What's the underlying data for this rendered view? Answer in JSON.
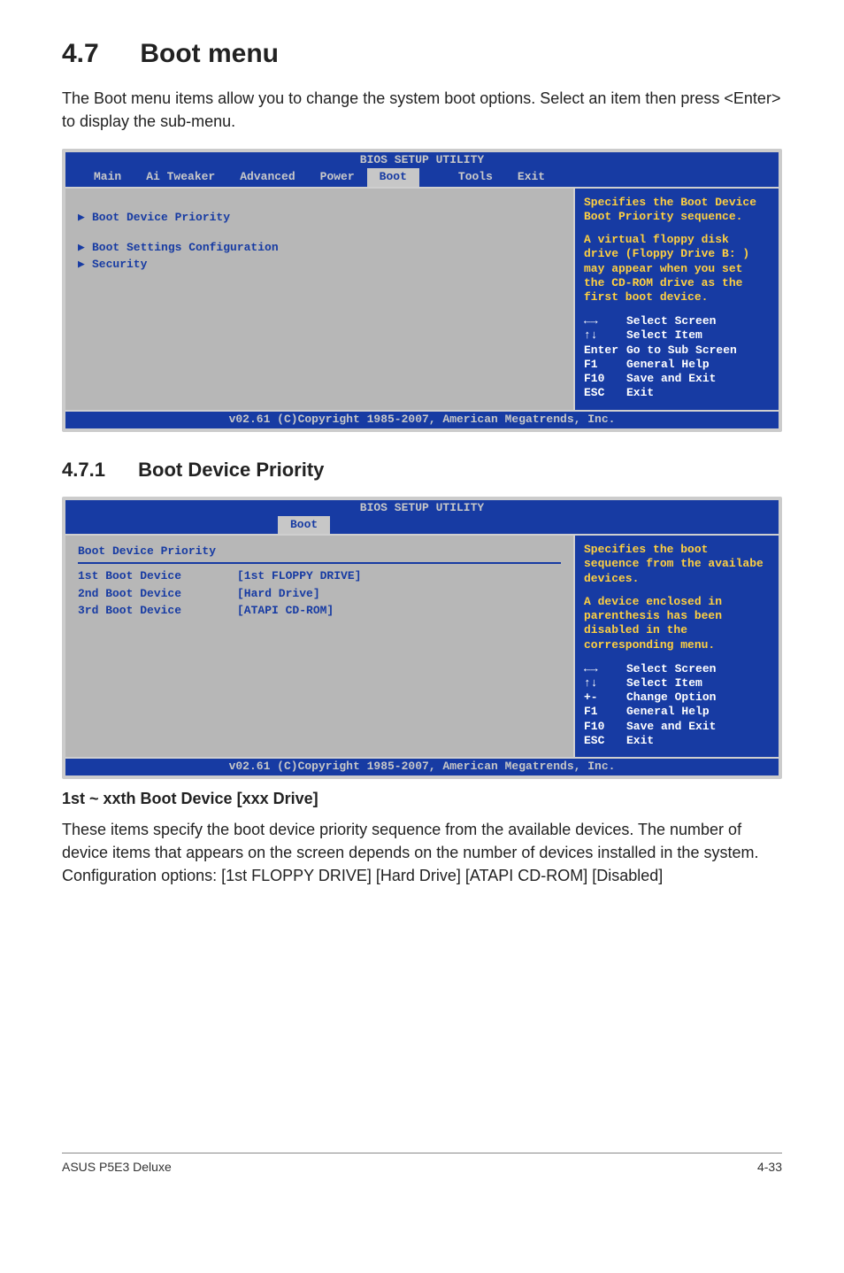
{
  "heading": {
    "num": "4.7",
    "title": "Boot menu"
  },
  "intro": "The Boot menu items allow you to change the system boot options. Select an item then press <Enter> to display the sub-menu.",
  "bios1": {
    "header": "BIOS SETUP UTILITY",
    "tabs": [
      "Main",
      "Ai Tweaker",
      "Advanced",
      "Power",
      "Boot",
      "Tools",
      "Exit"
    ],
    "selectedTab": "Boot",
    "left_items": [
      {
        "arrow": true,
        "label": "Boot Device Priority"
      },
      {
        "arrow": true,
        "label": "Boot Settings Configuration"
      },
      {
        "arrow": true,
        "label": "Security"
      }
    ],
    "right_desc1": "Specifies the Boot Device Boot Priority sequence.",
    "right_desc2": "A virtual floppy disk drive (Floppy Drive B: ) may appear when you set the CD-ROM drive as the first boot device.",
    "nav": [
      {
        "key": "←→",
        "label": "Select Screen"
      },
      {
        "key": "↑↓",
        "label": "Select Item"
      },
      {
        "key": "Enter",
        "label": "Go to Sub Screen"
      },
      {
        "key": "F1",
        "label": "General Help"
      },
      {
        "key": "F10",
        "label": "Save and Exit"
      },
      {
        "key": "ESC",
        "label": "Exit"
      }
    ],
    "footer": "v02.61 (C)Copyright 1985-2007, American Megatrends, Inc."
  },
  "subheading": {
    "num": "4.7.1",
    "title": "Boot Device Priority"
  },
  "bios2": {
    "header": "BIOS SETUP UTILITY",
    "single_tab": "Boot",
    "section_head": "Boot Device Priority",
    "rows": [
      {
        "label": "1st Boot Device",
        "value": "[1st FLOPPY DRIVE]"
      },
      {
        "label": "2nd Boot Device",
        "value": "[Hard Drive]"
      },
      {
        "label": "3rd Boot Device",
        "value": "[ATAPI CD-ROM]"
      }
    ],
    "right_desc1": "Specifies the boot sequence from the availabe devices.",
    "right_desc2": "A device enclosed in parenthesis has been disabled in the corresponding menu.",
    "nav": [
      {
        "key": "←→",
        "label": "Select Screen"
      },
      {
        "key": "↑↓",
        "label": "Select Item"
      },
      {
        "key": "+-",
        "label": "Change Option"
      },
      {
        "key": "F1",
        "label": "General Help"
      },
      {
        "key": "F10",
        "label": "Save and Exit"
      },
      {
        "key": "ESC",
        "label": "Exit"
      }
    ],
    "footer": "v02.61 (C)Copyright 1985-2007, American Megatrends, Inc."
  },
  "para_title": "1st ~ xxth Boot Device [xxx Drive]",
  "para_body": "These items specify the boot device priority sequence from the available devices. The number of device items that appears on the screen depends on the number of devices installed in the system. Configuration options: [1st FLOPPY DRIVE] [Hard Drive] [ATAPI CD-ROM] [Disabled]",
  "footer_left": "ASUS P5E3 Deluxe",
  "footer_right": "4-33"
}
